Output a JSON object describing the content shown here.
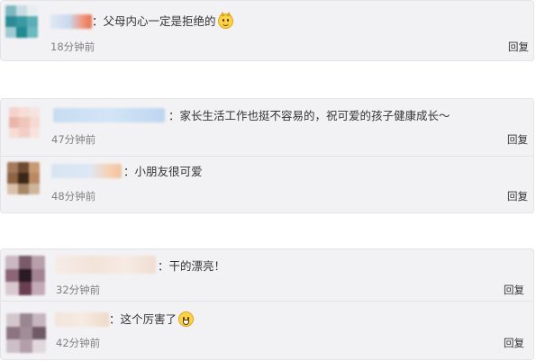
{
  "comments": [
    {
      "text": "：父母内心一定是拒绝的",
      "time": "18分钟前",
      "reply_label": "回复",
      "emoji": "cat-smirk-emoji"
    },
    {
      "text": "：家长生活工作也挺不容易的，祝可爱的孩子健康成长～",
      "time": "47分钟前",
      "reply_label": "回复"
    },
    {
      "text": "：小朋友很可爱",
      "time": "48分钟前",
      "reply_label": "回复"
    },
    {
      "text": "：干的漂亮！",
      "time": "32分钟前",
      "reply_label": "回复"
    },
    {
      "text": "：这个厉害了",
      "time": "42分钟前",
      "reply_label": "回复",
      "emoji": "grinning-emoji"
    }
  ],
  "colors": {
    "card_background": "#f2f2f5",
    "card_border": "#e3e3e8",
    "time_text": "#808080",
    "body_text": "#333333",
    "emoji_yellow": "#fcd347"
  }
}
